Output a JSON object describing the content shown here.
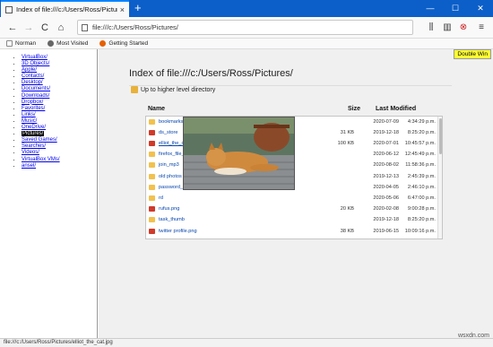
{
  "tab": {
    "title": "Index of file:///c:/Users/Ross/Pictures/",
    "close": "×"
  },
  "newtab": "+",
  "window_controls": {
    "minimize": "—",
    "maximize": "☐",
    "close": "✕"
  },
  "nav": {
    "back": "←",
    "forward": "→",
    "reload": "C",
    "home": "⌂"
  },
  "url": "file:///c:/Users/Ross/Pictures/",
  "toolbar": {
    "library": "⫼",
    "sidebar": "▥",
    "extension": "⊗",
    "menu": "≡"
  },
  "bookmarks": [
    {
      "label": "Norman",
      "icon": "page-icon",
      "color": "#888888"
    },
    {
      "label": "Most Visited",
      "icon": "gear-icon",
      "color": "#666666"
    },
    {
      "label": "Getting Started",
      "icon": "firefox-icon",
      "color": "#e66000"
    }
  ],
  "sidebar": {
    "items": [
      "VirtualBox/",
      "3D Objects/",
      "Apple/",
      "Contacts/",
      "Desktop/",
      "Documents/",
      "Downloads/",
      "Dropbox/",
      "Favorites/",
      "Links/",
      "Music/",
      "OneDrive/",
      "Pictures/",
      "Saved Games/",
      "Searches/",
      "Videos/",
      "VirtualBox VMs/",
      "ansel/"
    ],
    "selected_index": 12
  },
  "double_win": "Double Win",
  "heading": "Index of file:///c:/Users/Ross/Pictures/",
  "up_link": "Up to higher level directory",
  "columns": {
    "name": "Name",
    "size": "Size",
    "modified": "Last Modified"
  },
  "files": [
    {
      "name": "bookmarks",
      "type": "folder",
      "size": "",
      "date": "2020-07-09",
      "time": "4:34:29 p.m."
    },
    {
      "name": "ds_store",
      "type": "file",
      "size": "31 KB",
      "date": "2019-12-18",
      "time": "8:25:20 p.m."
    },
    {
      "name": "elliot_the_cat.jpg",
      "type": "file",
      "size": "100 KB",
      "date": "2020-07-01",
      "time": "10:45:57 p.m."
    },
    {
      "name": "firefox_file_manager",
      "type": "folder",
      "size": "",
      "date": "2020-06-12",
      "time": "12:45:49 p.m."
    },
    {
      "name": "join_mp3",
      "type": "folder",
      "size": "",
      "date": "2020-08-02",
      "time": "11:58:36 p.m."
    },
    {
      "name": "old photos",
      "type": "folder",
      "size": "",
      "date": "2019-12-13",
      "time": "2:45:39 p.m."
    },
    {
      "name": "password_zip",
      "type": "folder",
      "size": "",
      "date": "2020-04-05",
      "time": "2:46:10 p.m."
    },
    {
      "name": "rd",
      "type": "folder",
      "size": "",
      "date": "2020-05-06",
      "time": "6:47:00 p.m."
    },
    {
      "name": "rufus.png",
      "type": "file",
      "size": "20 KB",
      "date": "2020-02-08",
      "time": "9:00:28 p.m."
    },
    {
      "name": "task_thumb",
      "type": "folder",
      "size": "",
      "date": "2019-12-18",
      "time": "8:25:20 p.m."
    },
    {
      "name": "twitter profile.png",
      "type": "file",
      "size": "38 KB",
      "date": "2019-06-15",
      "time": "10:09:16 p.m."
    }
  ],
  "status": "file:///c:/Users/Ross/Pictures/elliot_the_cat.jpg",
  "watermark": "wsxdn.com"
}
